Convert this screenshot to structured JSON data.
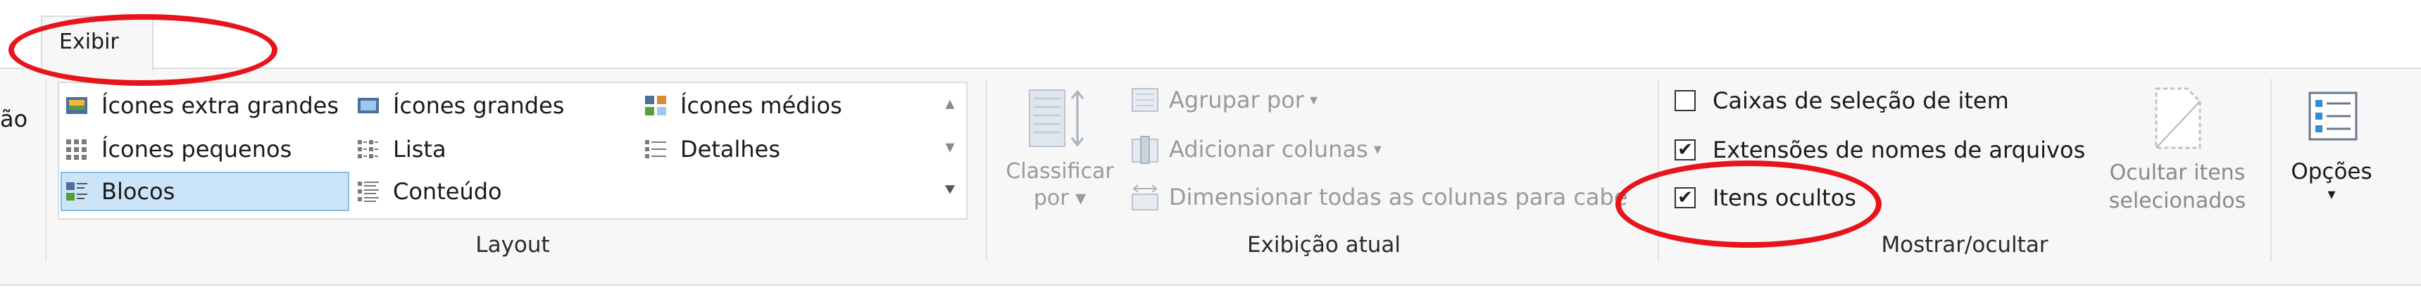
{
  "tabs": {
    "active": "Exibir"
  },
  "left_cut_text": "ão",
  "layout": {
    "items": [
      "Ícones extra grandes",
      "Ícones grandes",
      "Ícones médios",
      "Ícones pequenos",
      "Lista",
      "Detalhes",
      "Blocos",
      "Conteúdo"
    ],
    "selected": "Blocos",
    "group_label": "Layout"
  },
  "current_view": {
    "sort_label_1": "Classificar",
    "sort_label_2": "por",
    "group_by": "Agrupar por",
    "add_columns": "Adicionar colunas",
    "size_all_columns": "Dimensionar todas as colunas para cabe",
    "group_label": "Exibição atual"
  },
  "show_hide": {
    "item_checkboxes": {
      "label": "Caixas de seleção de item",
      "checked": false
    },
    "file_extensions": {
      "label": "Extensões de nomes de arquivos",
      "checked": true
    },
    "hidden_items": {
      "label": "Itens ocultos",
      "checked": true
    },
    "hide_selected_1": "Ocultar itens",
    "hide_selected_2": "selecionados",
    "group_label": "Mostrar/ocultar"
  },
  "options": {
    "label": "Opções"
  },
  "colors": {
    "annotation": "#e8131b",
    "selection_bg": "#cce4f7",
    "ribbon_bg": "#f7f7f7"
  }
}
